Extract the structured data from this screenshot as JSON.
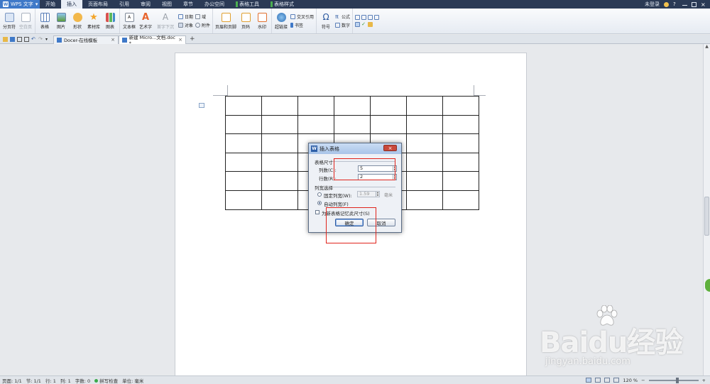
{
  "titlebar": {
    "app_name": "WPS 文字",
    "tabs": [
      {
        "label": "开始",
        "active": false,
        "contextual": false
      },
      {
        "label": "插入",
        "active": true,
        "contextual": false
      },
      {
        "label": "页面布局",
        "active": false,
        "contextual": false
      },
      {
        "label": "引用",
        "active": false,
        "contextual": false
      },
      {
        "label": "审阅",
        "active": false,
        "contextual": false
      },
      {
        "label": "视图",
        "active": false,
        "contextual": false
      },
      {
        "label": "章节",
        "active": false,
        "contextual": false
      },
      {
        "label": "办公空间",
        "active": false,
        "contextual": false
      },
      {
        "label": "表格工具",
        "active": false,
        "contextual": true
      },
      {
        "label": "表格样式",
        "active": false,
        "contextual": true
      }
    ],
    "login_status": "未登录"
  },
  "ribbon": {
    "page_break": "分页符",
    "blank_page": "空白页",
    "table": "表格",
    "picture": "图片",
    "shape": "形状",
    "material": "素材库",
    "chart": "图表",
    "textbox": "文本框",
    "wordart": "艺术字",
    "drop_cap": "首字下沉",
    "date": "日期",
    "field": "域",
    "object": "对象",
    "attachment": "附件",
    "header_footer": "页眉和页脚",
    "page_number": "页码",
    "watermark": "水印",
    "hyperlink": "超链接",
    "cross_ref": "交叉引用",
    "bookmark": "书签",
    "symbol": "符号",
    "formula": "公式",
    "number": "数字"
  },
  "tabsbar": {
    "tabs": [
      {
        "label": "Docer-在线模板"
      },
      {
        "label": "新建 Micro...文档.doc *"
      }
    ]
  },
  "document": {
    "table_rows": 6,
    "table_cols": 7
  },
  "dialog": {
    "title": "插入表格",
    "size_section": "表格尺寸",
    "cols_label": "列数(C):",
    "cols_value": "5",
    "rows_label": "行数(R):",
    "rows_value": "2",
    "width_section": "列宽选择",
    "fixed_label": "固定列宽(W):",
    "fixed_value": "1.59",
    "unit": "毫米",
    "auto_label": "自动列宽(F)",
    "remember_label": "为新表格记忆此尺寸(S)",
    "ok": "确定",
    "cancel": "取消",
    "auto_checked": true,
    "remember_checked": false
  },
  "statusbar": {
    "page": "页面: 1/1",
    "section": "节: 1/1",
    "row": "行: 1",
    "col": "列: 1",
    "words": "字数: 0",
    "spell": "拼写检查",
    "unit": "单位: 毫米",
    "zoom": "120 %"
  },
  "watermark": {
    "brand": "Baidu经验",
    "url": "jingyan.baidu.com"
  },
  "colors": {
    "menu_bg": "#2b3a55",
    "accent": "#3f79c8",
    "highlight_box": "#e0241c"
  }
}
